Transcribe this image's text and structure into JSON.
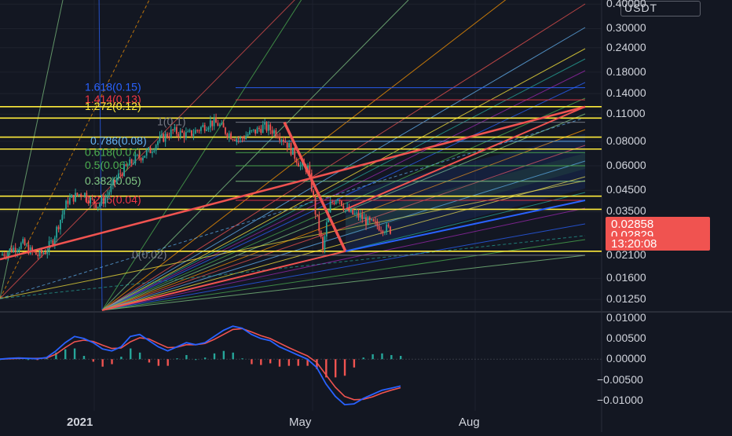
{
  "quote_currency": "USDT",
  "price_scale": {
    "labels": [
      "0.40000",
      "0.30000",
      "0.24000",
      "0.18000",
      "0.14000",
      "0.11000",
      "0.08000",
      "0.06000",
      "0.04500",
      "0.03500",
      "0.02100",
      "0.01600",
      "0.01250"
    ],
    "log_scale": true
  },
  "indicator_scale": {
    "labels": [
      "0.01000",
      "0.00500",
      "0.00000",
      "−0.00500",
      "−0.01000"
    ]
  },
  "time_axis": {
    "labels": [
      "2021",
      "May",
      "Aug"
    ]
  },
  "price_tags": [
    {
      "name": "last-price",
      "value": "0.02858",
      "color": "#f05350"
    },
    {
      "name": "close-price",
      "value": "0.02829",
      "color": "#f05350"
    },
    {
      "name": "countdown",
      "value": "13:20:08",
      "color": "#f05350"
    }
  ],
  "fib_levels": [
    {
      "label": "1.618(0.15)",
      "color": "#2962ff",
      "value": 0.15
    },
    {
      "label": "1.414(0.13)",
      "color": "#f23645",
      "value": 0.13
    },
    {
      "label": "1.272(0.12)",
      "color": "#ffeb3b",
      "value": 0.12
    },
    {
      "label": "1(0.1)",
      "color": "#787b86",
      "value": 0.1
    },
    {
      "label": "0.786(0.08)",
      "color": "#64b5f6",
      "value": 0.08
    },
    {
      "label": "0.618(0.07)",
      "color": "#4caf50",
      "value": 0.07
    },
    {
      "label": "0.5(0.06)",
      "color": "#4caf50",
      "value": 0.06
    },
    {
      "label": "0.382(0.05)",
      "color": "#81c784",
      "value": 0.05
    },
    {
      "label": "0.236(0.04)",
      "color": "#f23645",
      "value": 0.04
    },
    {
      "label": "0(0.02)",
      "color": "#787b86",
      "value": 0.021
    }
  ],
  "colors": {
    "background": "#131722",
    "up": "#26a69a",
    "down": "#f05350",
    "grid": "#1e222d",
    "yellow_level": "#ffeb3b",
    "macd_line": "#2962ff",
    "signal_line": "#f05350"
  },
  "chart_data": {
    "type": "candlestick",
    "ylim": [
      0.011,
      0.42
    ],
    "y_scale": "log",
    "horizontal_levels": [
      0.12,
      0.105,
      0.084,
      0.073,
      0.042,
      0.036,
      0.022
    ],
    "close_series_approx": [
      0.021,
      0.022,
      0.023,
      0.024,
      0.022,
      0.021,
      0.022,
      0.025,
      0.032,
      0.04,
      0.042,
      0.044,
      0.04,
      0.038,
      0.041,
      0.048,
      0.055,
      0.06,
      0.065,
      0.068,
      0.072,
      0.08,
      0.085,
      0.09,
      0.088,
      0.086,
      0.09,
      0.095,
      0.1,
      0.098,
      0.09,
      0.085,
      0.082,
      0.087,
      0.09,
      0.095,
      0.092,
      0.088,
      0.08,
      0.07,
      0.06,
      0.058,
      0.035,
      0.022,
      0.038,
      0.042,
      0.036,
      0.034,
      0.033,
      0.031,
      0.03,
      0.029,
      0.0283
    ],
    "macd": [
      0,
      0.0002,
      0.0003,
      0.0002,
      0.0001,
      0.0004,
      0.002,
      0.004,
      0.0055,
      0.005,
      0.004,
      0.0025,
      0.002,
      0.003,
      0.0055,
      0.006,
      0.0045,
      0.003,
      0.002,
      0.003,
      0.004,
      0.0035,
      0.004,
      0.0055,
      0.007,
      0.008,
      0.0075,
      0.006,
      0.005,
      0.0045,
      0.003,
      0.002,
      0.001,
      0,
      -0.002,
      -0.006,
      -0.009,
      -0.011,
      -0.0108,
      -0.0095,
      -0.0085,
      -0.0075,
      -0.007,
      -0.0065
    ],
    "signal": [
      0,
      0.0001,
      0.0002,
      0.0002,
      0.0002,
      0.0003,
      0.0012,
      0.0028,
      0.0042,
      0.0046,
      0.0043,
      0.0034,
      0.0026,
      0.0027,
      0.0042,
      0.0052,
      0.0049,
      0.0038,
      0.0028,
      0.0029,
      0.0035,
      0.0035,
      0.0038,
      0.0048,
      0.006,
      0.0072,
      0.0074,
      0.0066,
      0.0057,
      0.005,
      0.0039,
      0.0028,
      0.0018,
      0.0008,
      -0.0008,
      -0.0038,
      -0.0068,
      -0.009,
      -0.0098,
      -0.0097,
      -0.0091,
      -0.0082,
      -0.0075,
      -0.0069
    ],
    "macd_ylim": [
      -0.0125,
      0.0105
    ]
  }
}
